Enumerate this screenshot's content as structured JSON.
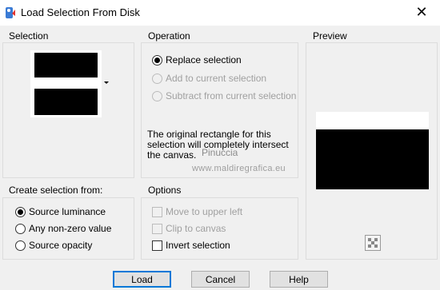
{
  "window": {
    "title": "Load Selection From Disk",
    "close_glyph": "✕"
  },
  "selection_group": {
    "label": "Selection"
  },
  "operation_group": {
    "label": "Operation",
    "options": [
      {
        "label": "Replace selection",
        "checked": true,
        "enabled": true
      },
      {
        "label": "Add to current selection",
        "checked": false,
        "enabled": false
      },
      {
        "label": "Subtract from current selection",
        "checked": false,
        "enabled": false
      }
    ],
    "info": "The original rectangle for this selection will completely intersect the canvas."
  },
  "preview_group": {
    "label": "Preview"
  },
  "create_from_group": {
    "label": "Create selection from:",
    "options": [
      {
        "label": "Source luminance",
        "checked": true
      },
      {
        "label": "Any non-zero value",
        "checked": false
      },
      {
        "label": "Source opacity",
        "checked": false
      }
    ]
  },
  "options_group": {
    "label": "Options",
    "options": [
      {
        "label": "Move to upper left",
        "checked": false,
        "enabled": false
      },
      {
        "label": "Clip to canvas",
        "checked": false,
        "enabled": false
      },
      {
        "label": "Invert selection",
        "checked": false,
        "enabled": true
      }
    ]
  },
  "watermark": {
    "name": "Pinuccia",
    "url": "www.maldiregrafica.eu"
  },
  "buttons": {
    "load": "Load",
    "cancel": "Cancel",
    "help": "Help"
  },
  "colors": {
    "dialog_bg": "#f0f0f0",
    "accent": "#0078d7"
  }
}
